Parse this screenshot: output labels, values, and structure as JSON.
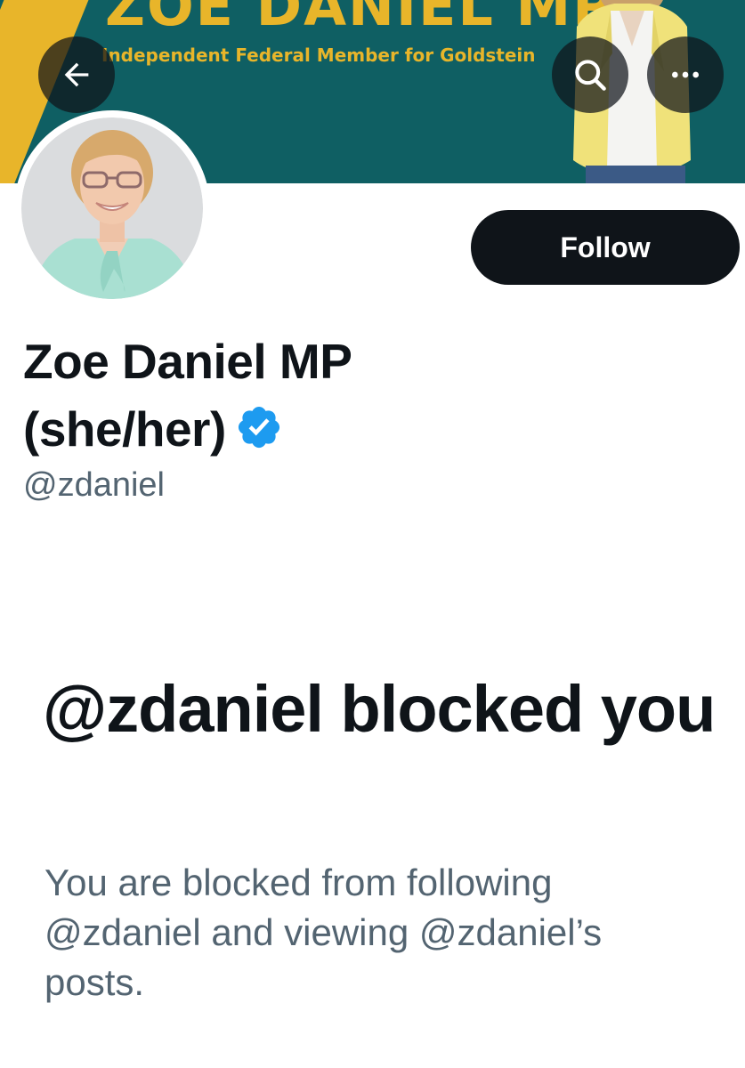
{
  "banner": {
    "title": "ZOE DANIEL MP",
    "subtitle": "Independent Federal Member for Goldstein",
    "colors": {
      "background": "#0f5f63",
      "accent": "#e8b52a"
    }
  },
  "header_buttons": {
    "back_icon": "arrow-left-icon",
    "search_icon": "search-icon",
    "more_icon": "more-horizontal-icon"
  },
  "profile": {
    "display_name_line1": "Zoe Daniel MP",
    "display_name_line2": "(she/her)",
    "verified_icon": "verified-badge-icon",
    "handle": "@zdaniel",
    "follow_label": "Follow"
  },
  "blocked": {
    "title": "@zdaniel blocked you",
    "description": "You are blocked from following @zdaniel and viewing @zdaniel’s posts."
  },
  "colors": {
    "primary_text": "#0f1419",
    "secondary_text": "#536471",
    "verified_blue": "#1d9bf0"
  }
}
